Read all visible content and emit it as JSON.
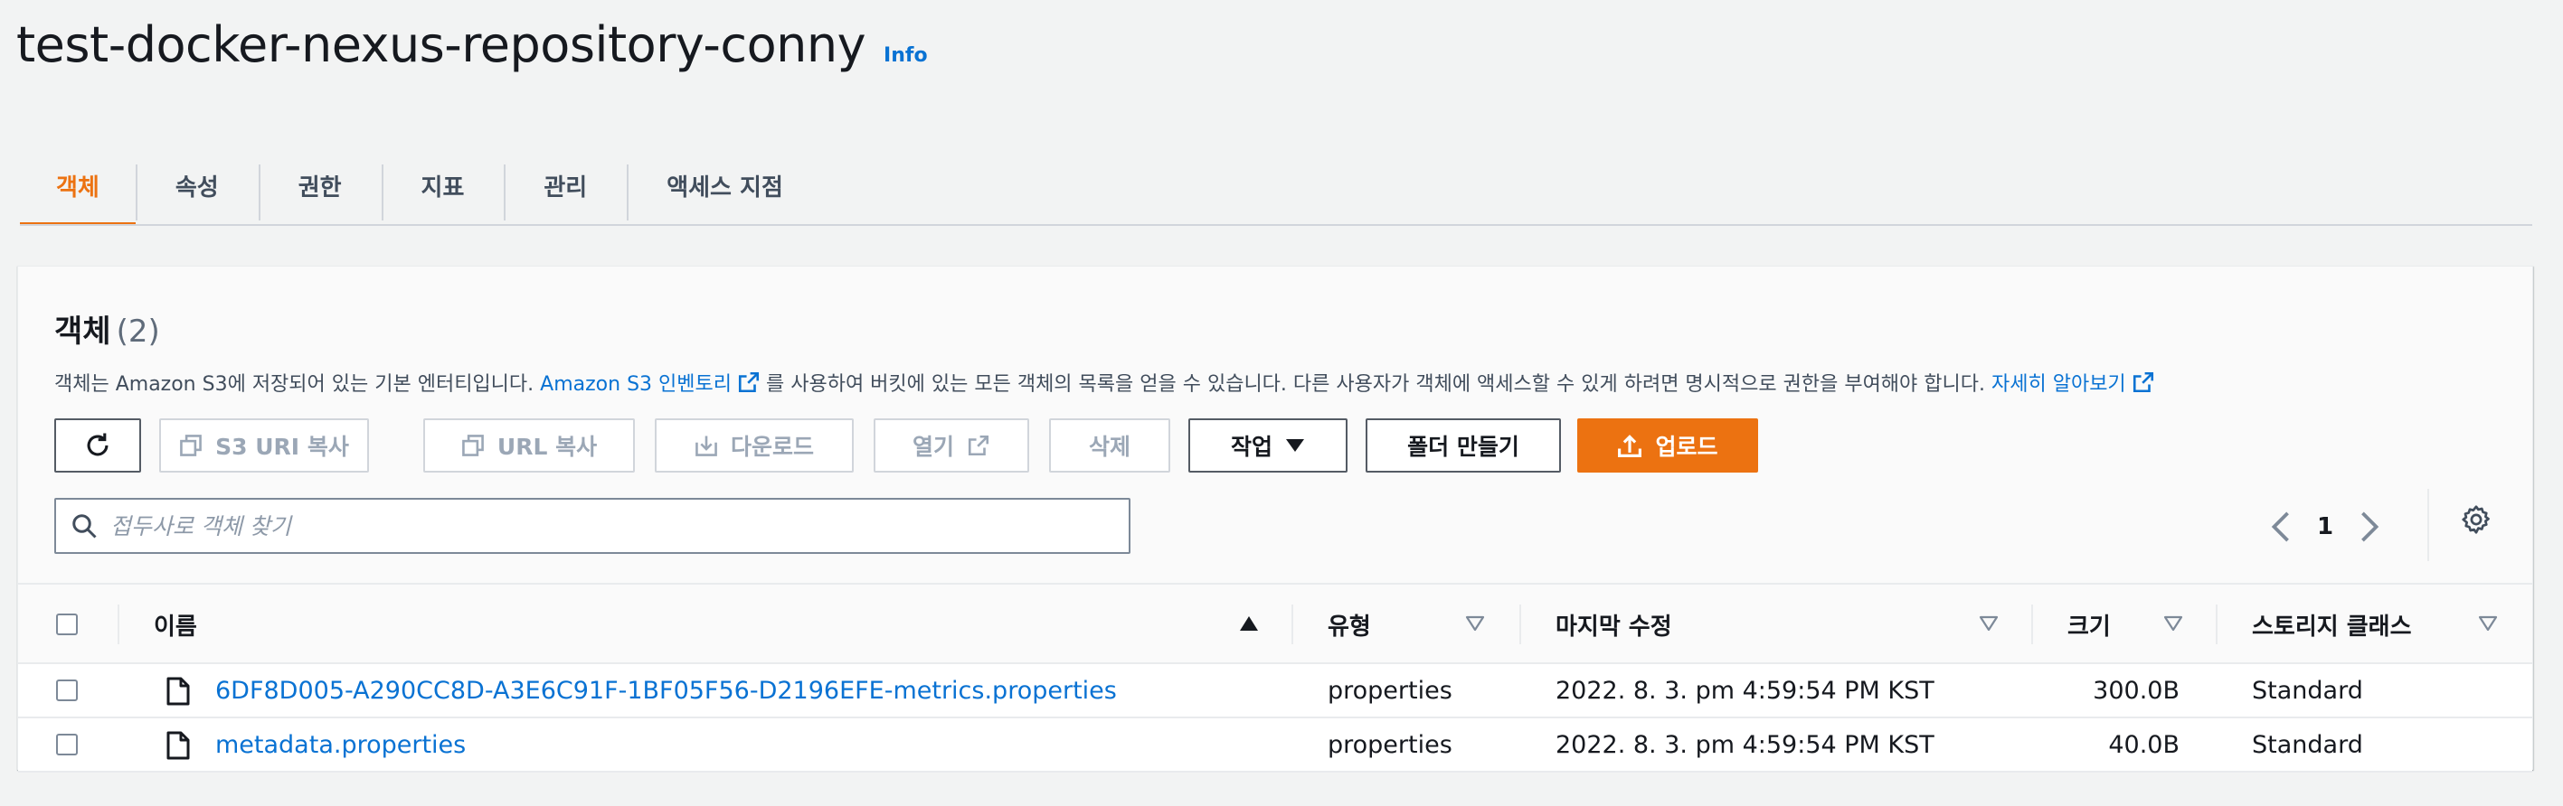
{
  "header": {
    "title": "test-docker-nexus-repository-conny",
    "info_label": "Info"
  },
  "tabs": [
    {
      "label": "객체",
      "active": true
    },
    {
      "label": "속성"
    },
    {
      "label": "권한"
    },
    {
      "label": "지표"
    },
    {
      "label": "관리"
    },
    {
      "label": "액세스 지점"
    }
  ],
  "objects_panel": {
    "heading": "객체",
    "count": "(2)",
    "description_pre": "객체는 Amazon S3에 저장되어 있는 기본 엔터티입니다.",
    "inventory_link": "Amazon S3 인벤토리",
    "description_post": "를 사용하여 버킷에 있는 모든 객체의 목록을 얻을 수 있습니다. 다른 사용자가 객체에 액세스할 수 있게 하려면 명시적으로 권한을 부여해야 합니다.",
    "learn_more_link": "자세히 알아보기"
  },
  "toolbar": {
    "copy_s3_uri": "S3 URI 복사",
    "copy_url": "URL 복사",
    "download": "다운로드",
    "open": "열기",
    "delete": "삭제",
    "actions": "작업",
    "create_folder": "폴더 만들기",
    "upload": "업로드"
  },
  "search": {
    "placeholder": "접두사로 객체 찾기"
  },
  "pagination": {
    "current_page": "1"
  },
  "table": {
    "columns": {
      "name": "이름",
      "type": "유형",
      "last_modified": "마지막 수정",
      "size": "크기",
      "storage_class": "스토리지 클래스"
    },
    "rows": [
      {
        "name": "6DF8D005-A290CC8D-A3E6C91F-1BF05F56-D2196EFE-metrics.properties",
        "type": "properties",
        "last_modified": "2022. 8. 3. pm 4:59:54 PM KST",
        "size": "300.0B",
        "storage_class": "Standard"
      },
      {
        "name": "metadata.properties",
        "type": "properties",
        "last_modified": "2022. 8. 3. pm 4:59:54 PM KST",
        "size": "40.0B",
        "storage_class": "Standard"
      }
    ]
  },
  "colors": {
    "accent": "#ec7211",
    "link": "#0972d3",
    "text": "#16191f",
    "disabled": "#9ba7b6"
  }
}
